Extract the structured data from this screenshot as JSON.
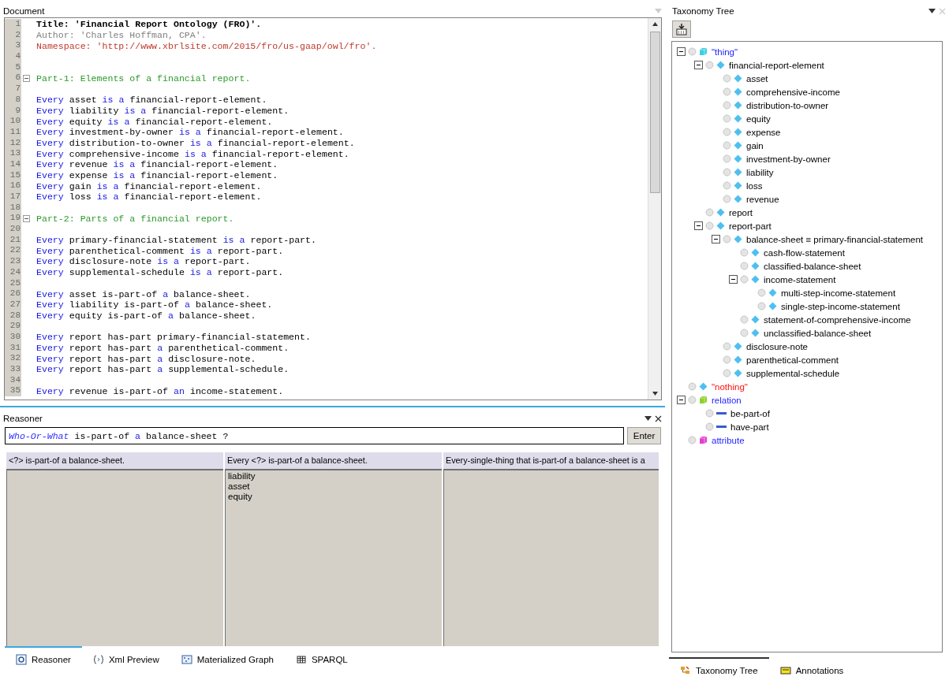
{
  "document": {
    "title": "Document",
    "lines": [
      {
        "number": "1",
        "kind": "title",
        "segments": [
          {
            "kind": "text",
            "text": "Title: 'Financial Report Ontology (FRO)'."
          }
        ]
      },
      {
        "number": "2",
        "kind": "author",
        "segments": [
          {
            "kind": "text",
            "text": "Author: 'Charles Hoffman, CPA'."
          }
        ]
      },
      {
        "number": "3",
        "kind": "namespace",
        "segments": [
          {
            "kind": "text",
            "text": "Namespace: 'http://www.xbrlsite.com/2015/fro/us-gaap/owl/fro'."
          }
        ]
      },
      {
        "number": "4",
        "kind": "blank"
      },
      {
        "number": "5",
        "kind": "blank"
      },
      {
        "number": "6",
        "kind": "heading",
        "folded": false,
        "segments": [
          {
            "kind": "text",
            "text": "Part-1: Elements of a financial report."
          }
        ]
      },
      {
        "number": "7",
        "kind": "blank"
      },
      {
        "number": "8",
        "kind": "statement",
        "segments": [
          {
            "kind": "kw",
            "text": "Every"
          },
          {
            "kind": "text",
            "text": "asset"
          },
          {
            "kind": "kw",
            "text": "is a"
          },
          {
            "kind": "text",
            "text": "financial-report-element."
          }
        ]
      },
      {
        "number": "9",
        "kind": "statement",
        "segments": [
          {
            "kind": "kw",
            "text": "Every"
          },
          {
            "kind": "text",
            "text": "liability"
          },
          {
            "kind": "kw",
            "text": "is a"
          },
          {
            "kind": "text",
            "text": "financial-report-element."
          }
        ]
      },
      {
        "number": "10",
        "kind": "statement",
        "segments": [
          {
            "kind": "kw",
            "text": "Every"
          },
          {
            "kind": "text",
            "text": "equity"
          },
          {
            "kind": "kw",
            "text": "is a"
          },
          {
            "kind": "text",
            "text": "financial-report-element."
          }
        ]
      },
      {
        "number": "11",
        "kind": "statement",
        "segments": [
          {
            "kind": "kw",
            "text": "Every"
          },
          {
            "kind": "text",
            "text": "investment-by-owner"
          },
          {
            "kind": "kw",
            "text": "is a"
          },
          {
            "kind": "text",
            "text": "financial-report-element."
          }
        ]
      },
      {
        "number": "12",
        "kind": "statement",
        "segments": [
          {
            "kind": "kw",
            "text": "Every"
          },
          {
            "kind": "text",
            "text": "distribution-to-owner"
          },
          {
            "kind": "kw",
            "text": "is a"
          },
          {
            "kind": "text",
            "text": "financial-report-element."
          }
        ]
      },
      {
        "number": "13",
        "kind": "statement",
        "segments": [
          {
            "kind": "kw",
            "text": "Every"
          },
          {
            "kind": "text",
            "text": "comprehensive-income"
          },
          {
            "kind": "kw",
            "text": "is a"
          },
          {
            "kind": "text",
            "text": "financial-report-element."
          }
        ]
      },
      {
        "number": "14",
        "kind": "statement",
        "segments": [
          {
            "kind": "kw",
            "text": "Every"
          },
          {
            "kind": "text",
            "text": "revenue"
          },
          {
            "kind": "kw",
            "text": "is a"
          },
          {
            "kind": "text",
            "text": "financial-report-element."
          }
        ]
      },
      {
        "number": "15",
        "kind": "statement",
        "segments": [
          {
            "kind": "kw",
            "text": "Every"
          },
          {
            "kind": "text",
            "text": "expense"
          },
          {
            "kind": "kw",
            "text": "is a"
          },
          {
            "kind": "text",
            "text": "financial-report-element."
          }
        ]
      },
      {
        "number": "16",
        "kind": "statement",
        "segments": [
          {
            "kind": "kw",
            "text": "Every"
          },
          {
            "kind": "text",
            "text": "gain"
          },
          {
            "kind": "kw",
            "text": "is a"
          },
          {
            "kind": "text",
            "text": "financial-report-element."
          }
        ]
      },
      {
        "number": "17",
        "kind": "statement",
        "segments": [
          {
            "kind": "kw",
            "text": "Every"
          },
          {
            "kind": "text",
            "text": "loss"
          },
          {
            "kind": "kw",
            "text": "is a"
          },
          {
            "kind": "text",
            "text": "financial-report-element."
          }
        ]
      },
      {
        "number": "18",
        "kind": "blank"
      },
      {
        "number": "19",
        "kind": "heading",
        "folded": false,
        "segments": [
          {
            "kind": "text",
            "text": "Part-2: Parts of a financial report."
          }
        ]
      },
      {
        "number": "20",
        "kind": "blank"
      },
      {
        "number": "21",
        "kind": "statement",
        "segments": [
          {
            "kind": "kw",
            "text": "Every"
          },
          {
            "kind": "text",
            "text": "primary-financial-statement"
          },
          {
            "kind": "kw",
            "text": "is a"
          },
          {
            "kind": "text",
            "text": "report-part."
          }
        ]
      },
      {
        "number": "22",
        "kind": "statement",
        "segments": [
          {
            "kind": "kw",
            "text": "Every"
          },
          {
            "kind": "text",
            "text": "parenthetical-comment"
          },
          {
            "kind": "kw",
            "text": "is a"
          },
          {
            "kind": "text",
            "text": "report-part."
          }
        ]
      },
      {
        "number": "23",
        "kind": "statement",
        "segments": [
          {
            "kind": "kw",
            "text": "Every"
          },
          {
            "kind": "text",
            "text": "disclosure-note"
          },
          {
            "kind": "kw",
            "text": "is a"
          },
          {
            "kind": "text",
            "text": "report-part."
          }
        ]
      },
      {
        "number": "24",
        "kind": "statement",
        "segments": [
          {
            "kind": "kw",
            "text": "Every"
          },
          {
            "kind": "text",
            "text": "supplemental-schedule"
          },
          {
            "kind": "kw",
            "text": "is a"
          },
          {
            "kind": "text",
            "text": "report-part."
          }
        ]
      },
      {
        "number": "25",
        "kind": "blank"
      },
      {
        "number": "26",
        "kind": "statement",
        "segments": [
          {
            "kind": "kw",
            "text": "Every"
          },
          {
            "kind": "text",
            "text": "asset is-part-of"
          },
          {
            "kind": "kw",
            "text": "a"
          },
          {
            "kind": "text",
            "text": "balance-sheet."
          }
        ]
      },
      {
        "number": "27",
        "kind": "statement",
        "segments": [
          {
            "kind": "kw",
            "text": "Every"
          },
          {
            "kind": "text",
            "text": "liability is-part-of"
          },
          {
            "kind": "kw",
            "text": "a"
          },
          {
            "kind": "text",
            "text": "balance-sheet."
          }
        ]
      },
      {
        "number": "28",
        "kind": "statement",
        "segments": [
          {
            "kind": "kw",
            "text": "Every"
          },
          {
            "kind": "text",
            "text": "equity is-part-of"
          },
          {
            "kind": "kw",
            "text": "a"
          },
          {
            "kind": "text",
            "text": "balance-sheet."
          }
        ]
      },
      {
        "number": "29",
        "kind": "blank"
      },
      {
        "number": "30",
        "kind": "statement",
        "segments": [
          {
            "kind": "kw",
            "text": "Every"
          },
          {
            "kind": "text",
            "text": "report has-part primary-financial-statement."
          }
        ]
      },
      {
        "number": "31",
        "kind": "statement",
        "segments": [
          {
            "kind": "kw",
            "text": "Every"
          },
          {
            "kind": "text",
            "text": "report has-part"
          },
          {
            "kind": "kw",
            "text": "a"
          },
          {
            "kind": "text",
            "text": "parenthetical-comment."
          }
        ]
      },
      {
        "number": "32",
        "kind": "statement",
        "segments": [
          {
            "kind": "kw",
            "text": "Every"
          },
          {
            "kind": "text",
            "text": "report has-part"
          },
          {
            "kind": "kw",
            "text": "a"
          },
          {
            "kind": "text",
            "text": "disclosure-note."
          }
        ]
      },
      {
        "number": "33",
        "kind": "statement",
        "segments": [
          {
            "kind": "kw",
            "text": "Every"
          },
          {
            "kind": "text",
            "text": "report has-part"
          },
          {
            "kind": "kw",
            "text": "a"
          },
          {
            "kind": "text",
            "text": "supplemental-schedule."
          }
        ]
      },
      {
        "number": "34",
        "kind": "blank"
      },
      {
        "number": "35",
        "kind": "statement",
        "segments": [
          {
            "kind": "kw",
            "text": "Every"
          },
          {
            "kind": "text",
            "text": "revenue is-part-of"
          },
          {
            "kind": "kw",
            "text": "an"
          },
          {
            "kind": "text",
            "text": "income-statement."
          }
        ]
      }
    ]
  },
  "reasoner": {
    "title": "Reasoner",
    "query": [
      {
        "kind": "var",
        "text": "Who-Or-What"
      },
      {
        "kind": "text",
        "text": "is-part-of"
      },
      {
        "kind": "kw",
        "text": "a"
      },
      {
        "kind": "text",
        "text": "balance-sheet ?"
      }
    ],
    "enter_button": "Enter",
    "columns": [
      {
        "header": "<?> is-part-of a balance-sheet."
      },
      {
        "header": "Every <?> is-part-of a balance-sheet.",
        "items": [
          "liability",
          "asset",
          "equity"
        ]
      },
      {
        "header": "Every-single-thing that is-part-of a balance-sheet is a"
      }
    ]
  },
  "bottom_tabs": [
    {
      "label": "Reasoner",
      "selected": true
    },
    {
      "label": "Xml Preview",
      "selected": false
    },
    {
      "label": "Materialized Graph",
      "selected": false
    },
    {
      "label": "SPARQL",
      "selected": false
    }
  ],
  "taxonomy": {
    "title": "Taxonomy Tree",
    "nodes": [
      {
        "label": "\"thing\"",
        "kind": "top",
        "color": "#3fd0e0",
        "expanded": true,
        "children": [
          {
            "label": "financial-report-element",
            "kind": "concept",
            "expanded": true,
            "children": [
              {
                "label": "asset",
                "kind": "concept"
              },
              {
                "label": "comprehensive-income",
                "kind": "concept"
              },
              {
                "label": "distribution-to-owner",
                "kind": "concept"
              },
              {
                "label": "equity",
                "kind": "concept"
              },
              {
                "label": "expense",
                "kind": "concept"
              },
              {
                "label": "gain",
                "kind": "concept"
              },
              {
                "label": "investment-by-owner",
                "kind": "concept"
              },
              {
                "label": "liability",
                "kind": "concept"
              },
              {
                "label": "loss",
                "kind": "concept"
              },
              {
                "label": "revenue",
                "kind": "concept"
              }
            ]
          },
          {
            "label": "report",
            "kind": "concept"
          },
          {
            "label": "report-part",
            "kind": "concept",
            "expanded": true,
            "children": [
              {
                "label": "balance-sheet ≡ primary-financial-statement",
                "kind": "concept",
                "expanded": true,
                "children": [
                  {
                    "label": "cash-flow-statement",
                    "kind": "concept"
                  },
                  {
                    "label": "classified-balance-sheet",
                    "kind": "concept"
                  },
                  {
                    "label": "income-statement",
                    "kind": "concept",
                    "expanded": true,
                    "children": [
                      {
                        "label": "multi-step-income-statement",
                        "kind": "concept"
                      },
                      {
                        "label": "single-step-income-statement",
                        "kind": "concept"
                      }
                    ]
                  },
                  {
                    "label": "statement-of-comprehensive-income",
                    "kind": "concept"
                  },
                  {
                    "label": "unclassified-balance-sheet",
                    "kind": "concept"
                  }
                ]
              },
              {
                "label": "disclosure-note",
                "kind": "concept"
              },
              {
                "label": "parenthetical-comment",
                "kind": "concept"
              },
              {
                "label": "supplemental-schedule",
                "kind": "concept"
              }
            ]
          }
        ]
      },
      {
        "label": "\"nothing\"",
        "kind": "bottom"
      },
      {
        "label": "relation",
        "kind": "top",
        "color": "#8cd12a",
        "expanded": true,
        "children": [
          {
            "label": "be-part-of",
            "kind": "role"
          },
          {
            "label": "have-part",
            "kind": "role"
          }
        ]
      },
      {
        "label": "attribute",
        "kind": "top",
        "color": "#e040d0"
      }
    ]
  },
  "side_tabs": [
    {
      "label": "Taxonomy Tree",
      "selected": true
    },
    {
      "label": "Annotations",
      "selected": false
    }
  ]
}
